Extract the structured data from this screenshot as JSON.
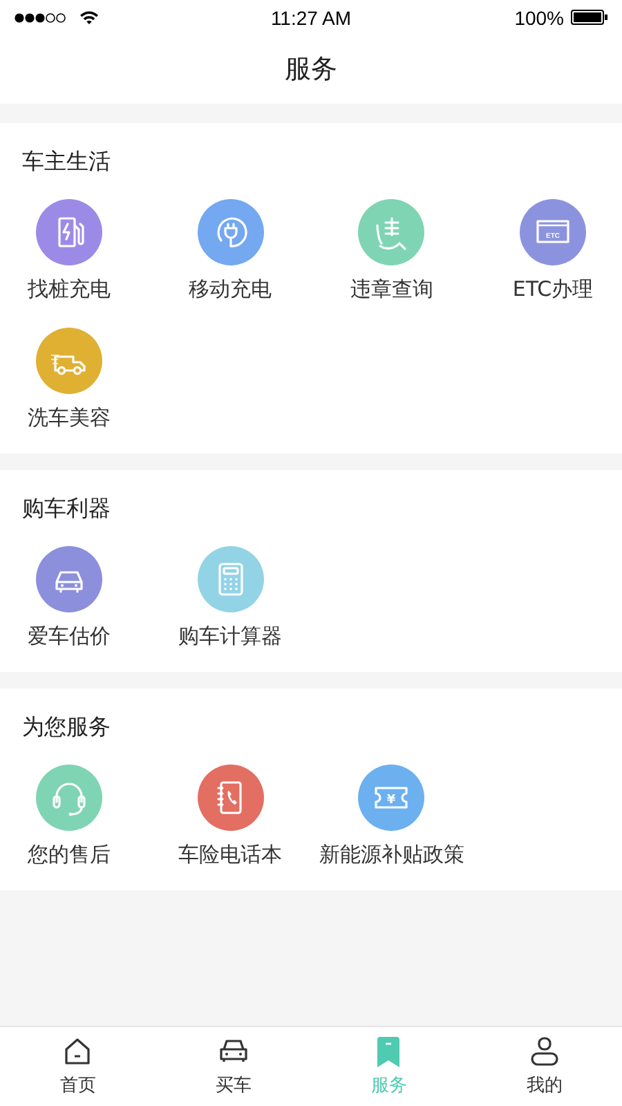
{
  "status_bar": {
    "time": "11:27 AM",
    "battery": "100%"
  },
  "header": {
    "title": "服务"
  },
  "sections": [
    {
      "title": "车主生活",
      "items": [
        {
          "label": "找桩充电",
          "color": "#9c8be6"
        },
        {
          "label": "移动充电",
          "color": "#74a8f0"
        },
        {
          "label": "违章查询",
          "color": "#7fd4b4"
        },
        {
          "label": "ETC办理",
          "color": "#8c93de",
          "icon_text": "ETC"
        },
        {
          "label": "洗车美容",
          "color": "#e0b033"
        }
      ]
    },
    {
      "title": "购车利器",
      "items": [
        {
          "label": "爱车估价",
          "color": "#8c8fdc"
        },
        {
          "label": "购车计算器",
          "color": "#93d3e6"
        }
      ]
    },
    {
      "title": "为您服务",
      "items": [
        {
          "label": "您的售后",
          "color": "#7fd4b4"
        },
        {
          "label": "车险电话本",
          "color": "#e36e62"
        },
        {
          "label": "新能源补贴政策",
          "color": "#6cb0f0",
          "icon_text": "¥"
        }
      ]
    }
  ],
  "tabs": [
    {
      "label": "首页",
      "selected": false
    },
    {
      "label": "买车",
      "selected": false
    },
    {
      "label": "服务",
      "selected": true
    },
    {
      "label": "我的",
      "selected": false
    }
  ]
}
